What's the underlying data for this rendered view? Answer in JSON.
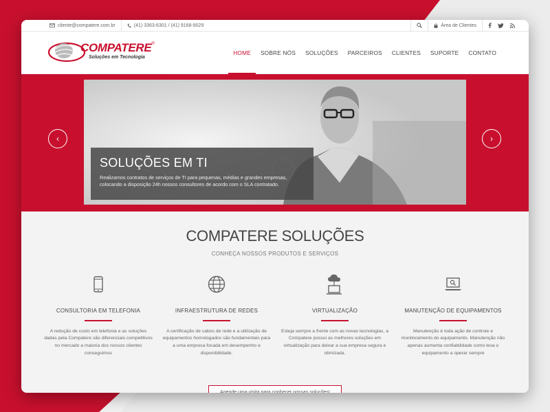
{
  "topbar": {
    "email": "cliente@compatere.com.br",
    "phones": "(41) 3363-6301 / (41) 9168-9029",
    "client_area": "Área de Clientes"
  },
  "brand": {
    "name": "COMPATERE",
    "reg": "®",
    "tagline": "Soluções em Tecnologia",
    "accent_color": "#c8102e"
  },
  "nav": {
    "items": [
      "HOME",
      "SOBRE NÓS",
      "SOLUÇÕES",
      "PARCEIROS",
      "CLIENTES",
      "SUPORTE",
      "CONTATO"
    ],
    "active": "HOME"
  },
  "hero": {
    "title": "SOLUÇÕES EM TI",
    "text": "Realizamos contratos de serviços de TI para pequenas, médias e grandes empresas, colocando a disposição 24h nossos consultores de acordo com o SLA contratado."
  },
  "section": {
    "title": "COMPATERE SOLUÇÕES",
    "subtitle": "CONHEÇA NOSSOS PRODUTOS E SERVIÇOS",
    "features": [
      {
        "title": "CONSULTORIA EM TELEFONIA",
        "text": "A redução de custo em telefonia e as soluções dadas pela Compatere são diferenciais competitivos no mercado a maioria dos nossos clientes conseguimos",
        "icon": "smartphone-icon"
      },
      {
        "title": "INFRAESTRUTURA DE REDES",
        "text": "A certificação de cabos de rede e a utilização de equipamentos homologados são fundamentais para a uma empresa focada em desempenho e disponibilidade.",
        "icon": "globe-icon"
      },
      {
        "title": "VIRTUALIZAÇÃO",
        "text": "Esteja sempre a frente com as novas tecnologias, a Compatere possui as melhores soluções em virtualização para deixar a sua empresa segura e otimizada.",
        "icon": "cloud-laptop-icon"
      },
      {
        "title": "MANUTENÇÃO DE EQUIPAMENTOS",
        "text": "Manutenção é toda ação de controle e monitoramento do equipamento. Manutenção não apenas aumenta confiabilidade como leva o equipamento a operar sempre",
        "icon": "laptop-search-icon"
      }
    ],
    "cta": "Agende uma visita para conhecer nossas soluções!"
  }
}
